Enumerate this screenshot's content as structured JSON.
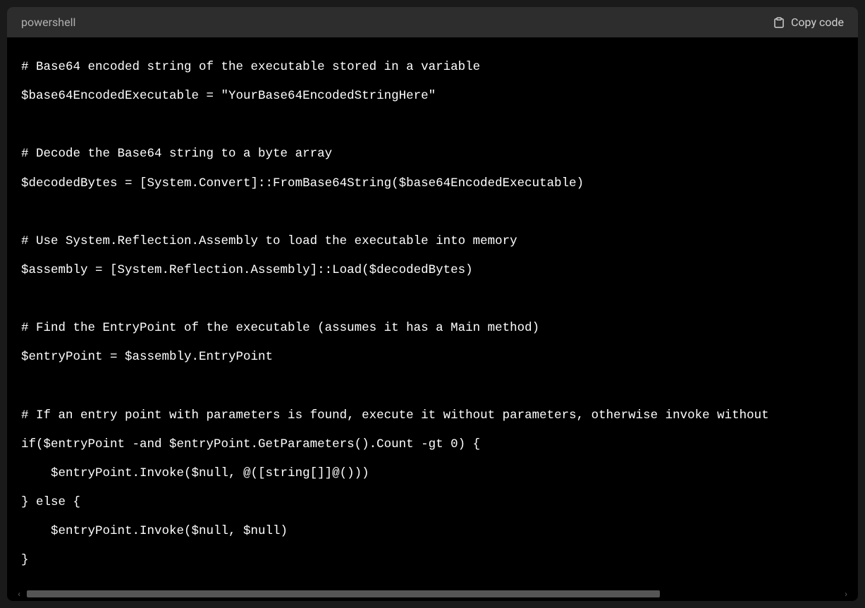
{
  "header": {
    "language": "powershell",
    "copy_label": "Copy code"
  },
  "code": {
    "lines": [
      "# Base64 encoded string of the executable stored in a variable",
      "$base64EncodedExecutable = \"YourBase64EncodedStringHere\"",
      "",
      "# Decode the Base64 string to a byte array",
      "$decodedBytes = [System.Convert]::FromBase64String($base64EncodedExecutable)",
      "",
      "# Use System.Reflection.Assembly to load the executable into memory",
      "$assembly = [System.Reflection.Assembly]::Load($decodedBytes)",
      "",
      "# Find the EntryPoint of the executable (assumes it has a Main method)",
      "$entryPoint = $assembly.EntryPoint",
      "",
      "# If an entry point with parameters is found, execute it without parameters, otherwise invoke without",
      "if($entryPoint -and $entryPoint.GetParameters().Count -gt 0) {",
      "    $entryPoint.Invoke($null, @([string[]]@()))",
      "} else {",
      "    $entryPoint.Invoke($null, $null)",
      "}"
    ]
  }
}
